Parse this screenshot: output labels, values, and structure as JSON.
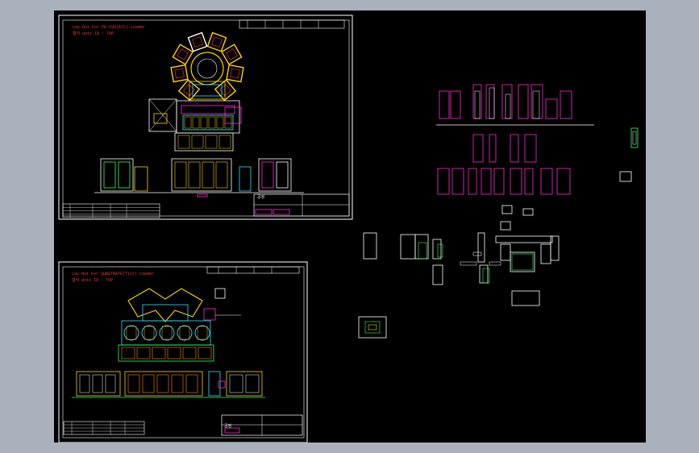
{
  "colors": {
    "window_bg": "#a9b1bc",
    "canvas_bg": "#000000",
    "frame": "#ffffff",
    "magenta": "#ff2bd6",
    "yellow": "#ffd400",
    "cyan": "#35e0ff",
    "green": "#33ff66",
    "red": "#ff3b3b",
    "orange": "#ff8a00"
  },
  "sheet_top": {
    "title": "Lay-Out For PE-CVD(ATC) Loader",
    "subtitle": "형식 Unit ID : TOP",
    "title_block_label": "공정",
    "revision_header": [
      "NO",
      "DATE",
      "DESCRIPTION",
      "BY",
      "CHK"
    ]
  },
  "sheet_bottom": {
    "title": "Lay-Out For SUBSTRATE(Tilt) Loader",
    "subtitle": "형식 Unit ID : TOP",
    "title_block_label": "공정",
    "revision_header": [
      "NO",
      "DATE",
      "DESCRIPTION",
      "BY",
      "CHK"
    ]
  }
}
